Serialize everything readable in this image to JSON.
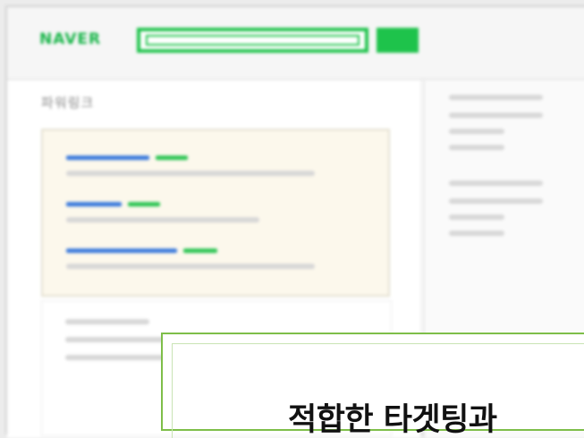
{
  "header": {
    "logo_text": "NAVER",
    "search": {
      "value": "",
      "placeholder": ""
    }
  },
  "sidebar": {
    "section_title": "파워링크"
  },
  "popup": {
    "headline": "적합한 타겟팅과"
  },
  "colors": {
    "brand_green": "#1ec34b",
    "link_blue": "#3a79dc",
    "ad_background": "#fcf8ec",
    "popup_border": "#7ebe49"
  }
}
